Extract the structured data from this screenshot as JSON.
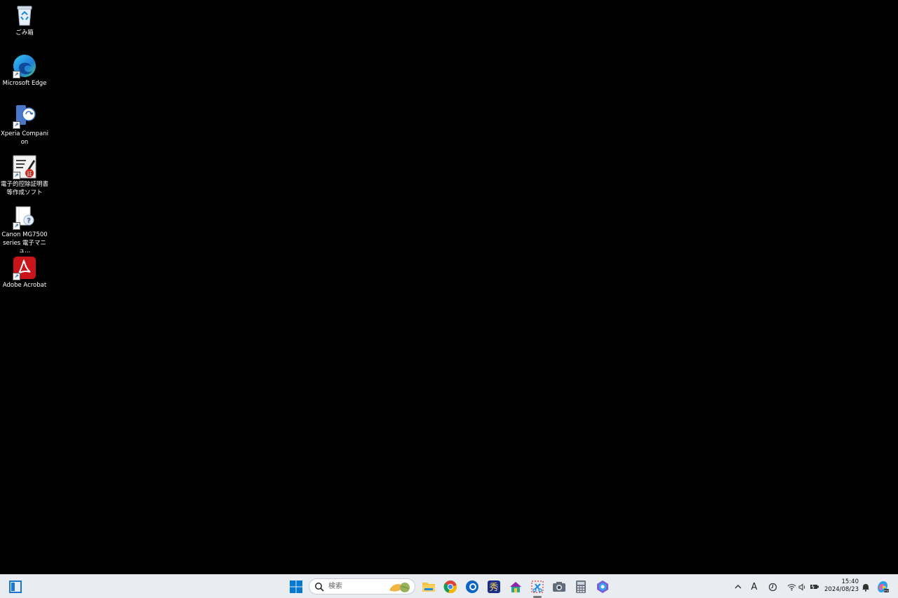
{
  "desktop": {
    "icons": [
      {
        "label": "ごみ箱",
        "icon": "recycle-bin-icon",
        "shortcut": false
      },
      {
        "label": "Microsoft Edge",
        "icon": "edge-icon",
        "shortcut": true
      },
      {
        "label": "Xperia Companion",
        "icon": "xperia-companion-icon",
        "shortcut": true
      },
      {
        "label": "電子的控除証明書等作成ソフト",
        "icon": "deduction-certificate-icon",
        "shortcut": true
      },
      {
        "label": "Canon MG7500 series 電子マニュ...",
        "icon": "canon-manual-icon",
        "shortcut": true
      },
      {
        "label": "Adobe Acrobat",
        "icon": "adobe-acrobat-icon",
        "shortcut": true
      }
    ]
  },
  "taskbar": {
    "search": {
      "placeholder": "検索"
    },
    "apps": [
      {
        "name": "start",
        "icon": "windows-start-icon"
      },
      {
        "name": "file-explorer",
        "icon": "folder-icon"
      },
      {
        "name": "chrome",
        "icon": "chrome-icon"
      },
      {
        "name": "outlook",
        "icon": "outlook-icon"
      },
      {
        "name": "app-hide",
        "icon": "calligraphy-app-icon"
      },
      {
        "name": "house-app",
        "icon": "house-icon"
      },
      {
        "name": "snipping-tool",
        "icon": "snipping-tool-icon"
      },
      {
        "name": "camera",
        "icon": "camera-icon"
      },
      {
        "name": "calculator",
        "icon": "calculator-icon"
      },
      {
        "name": "copilot",
        "icon": "copilot-icon"
      }
    ],
    "tray": {
      "ime": "A",
      "time": "15:40",
      "date": "2024/08/23"
    }
  },
  "colors": {
    "desktop_bg": "#000000",
    "taskbar_bg": "#e9ecf1",
    "windows_blue": "#0078d4"
  }
}
